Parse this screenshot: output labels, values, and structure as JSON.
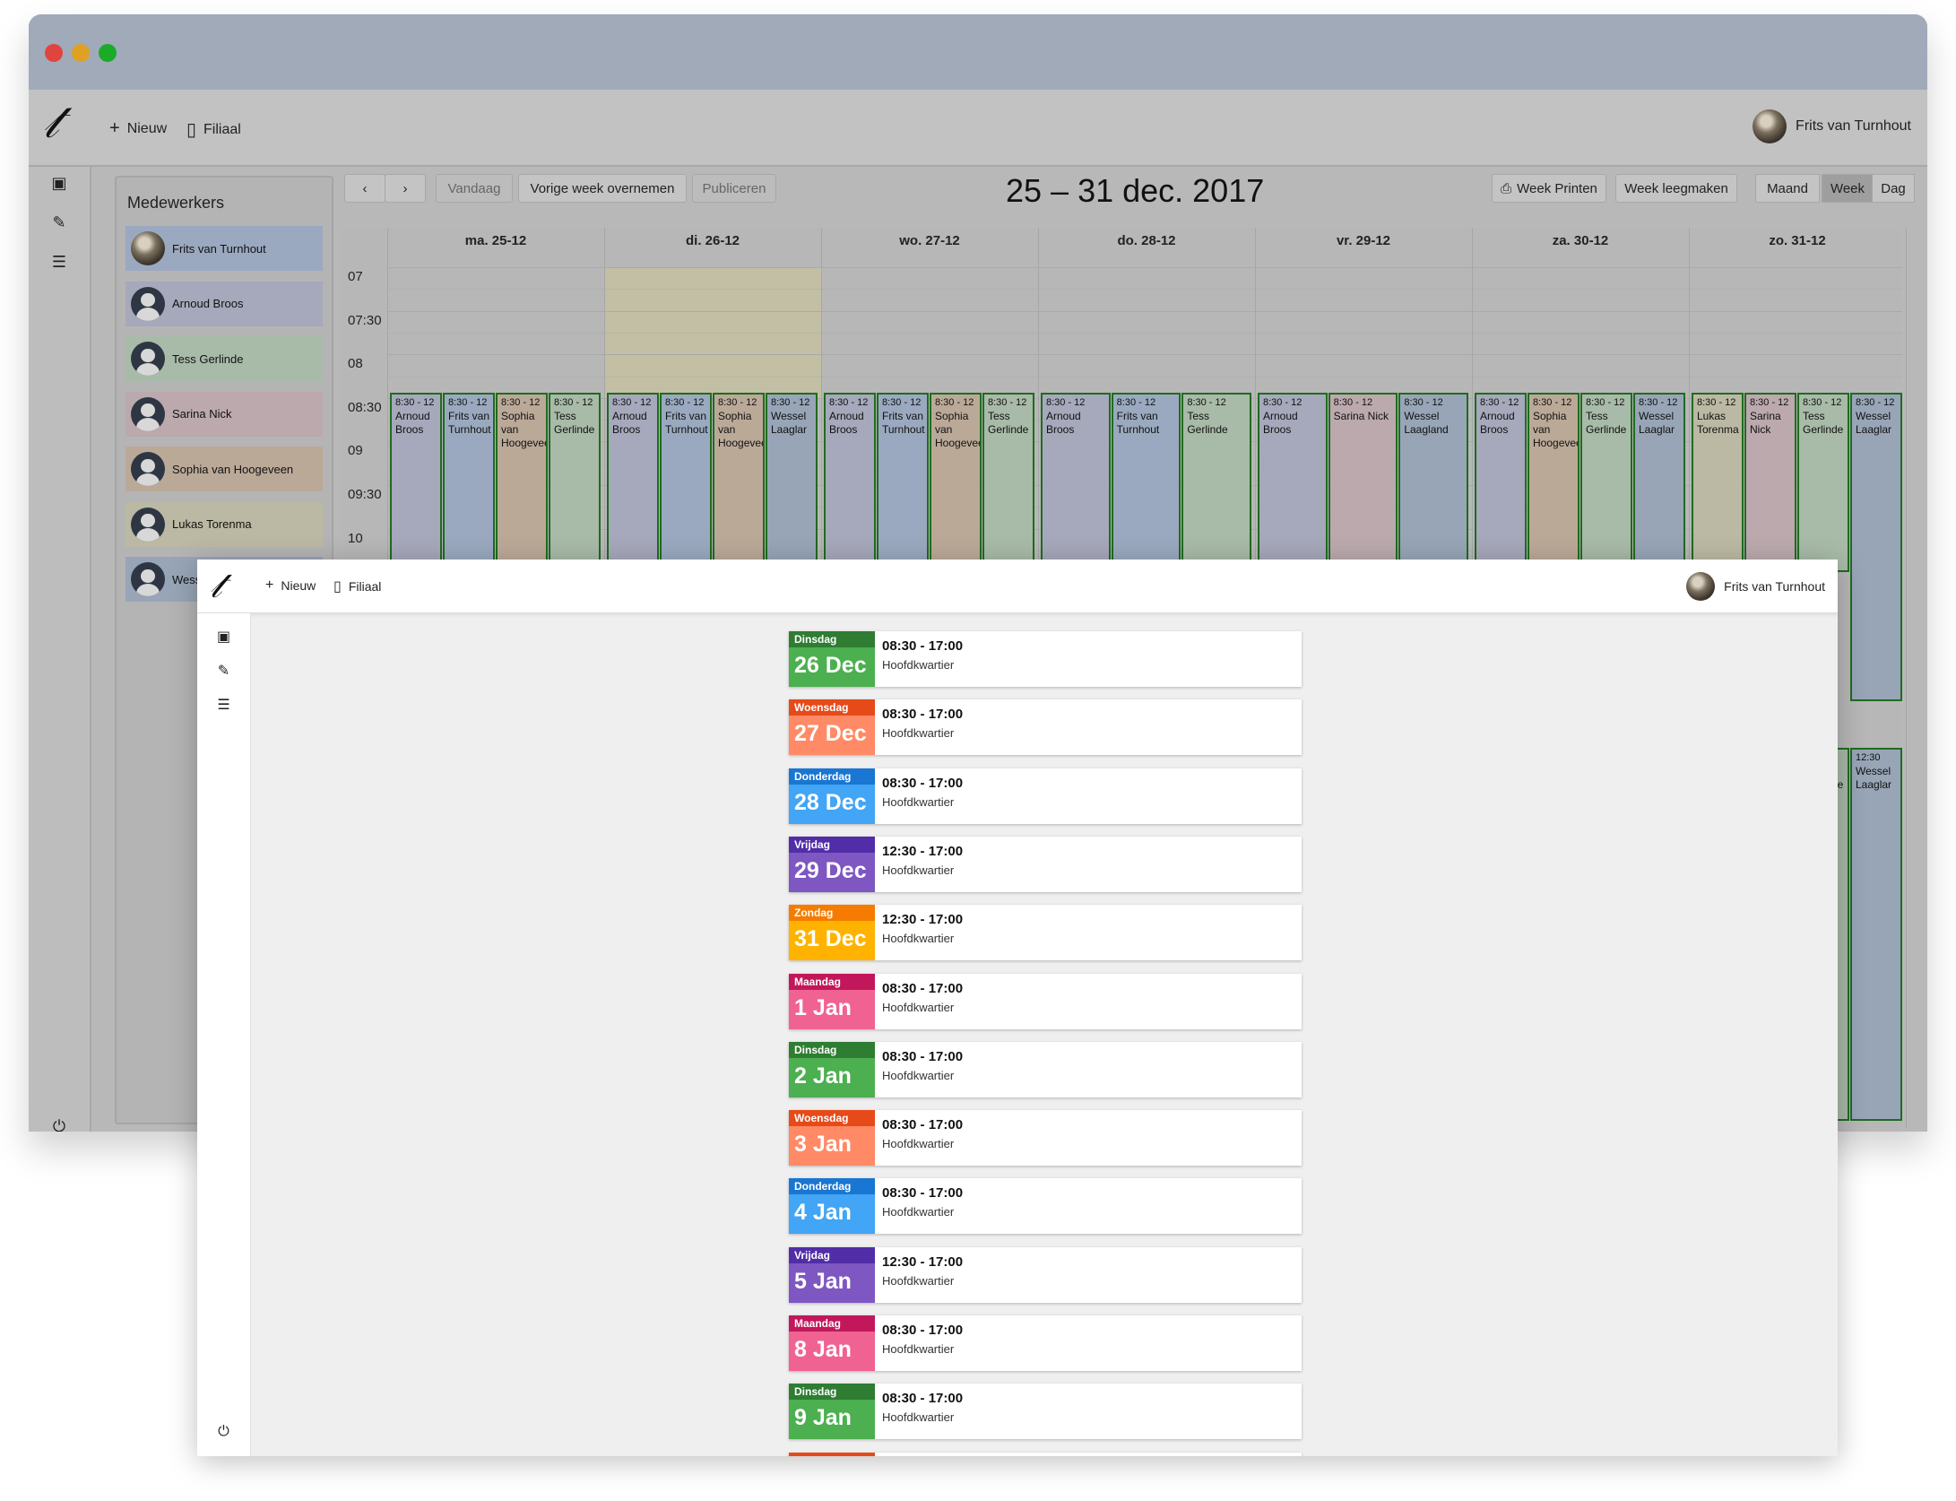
{
  "back": {
    "toolbar": {
      "new": "Nieuw",
      "branch": "Filiaal",
      "user": "Frits van Turnhout"
    },
    "employees_title": "Medewerkers",
    "employees": [
      {
        "name": "Frits van Turnhout",
        "color": "#9aa9bf",
        "photo": true
      },
      {
        "name": "Arnoud Broos",
        "color": "#a6a8bb",
        "photo": false
      },
      {
        "name": "Tess Gerlinde",
        "color": "#a8baa8",
        "photo": false
      },
      {
        "name": "Sarina Nick",
        "color": "#bba9ad",
        "photo": false
      },
      {
        "name": "Sophia van Hoogeveen",
        "color": "#bba998",
        "photo": false
      },
      {
        "name": "Lukas Torenma",
        "color": "#bbb9a3",
        "photo": false
      },
      {
        "name": "Wess",
        "color": "#97a5b7",
        "photo": false
      }
    ],
    "nav": {
      "prev": "‹",
      "next": "›",
      "today": "Vandaag",
      "copy_prev": "Vorige week overnemen",
      "publish": "Publiceren"
    },
    "week_title": "25 – 31 dec. 2017",
    "actions": {
      "print": "Week Printen",
      "clear": "Week leegmaken"
    },
    "views": [
      "Maand",
      "Week",
      "Dag"
    ],
    "active_view": "Week",
    "days": [
      "ma. 25-12",
      "di. 26-12",
      "wo. 27-12",
      "do. 28-12",
      "vr. 29-12",
      "za. 30-12",
      "zo. 31-12"
    ],
    "hours": [
      "07",
      "07:30",
      "08",
      "08:30",
      "09",
      "09:30",
      "10"
    ],
    "shift_time": "8:30 - 12",
    "shift_time_late": "12:30",
    "shifts": [
      [
        "Arnoud Broos",
        "Frits van Turnhout",
        "Sophia van Hoogeveen",
        "Tess Gerlinde"
      ],
      [
        "Arnoud Broos",
        "Frits van Turnhout",
        "Sophia van Hoogeveen",
        "Wessel Laaglar"
      ],
      [
        "Arnoud Broos",
        "Frits van Turnhout",
        "Sophia van Hoogeveen",
        "Tess Gerlinde"
      ],
      [
        "Arnoud Broos",
        "Frits van Turnhout",
        "Tess Gerlinde"
      ],
      [
        "Arnoud Broos",
        "Sarina Nick",
        "Wessel Laagland"
      ],
      [
        "Arnoud Broos",
        "Sophia van Hoogeveen",
        "Tess Gerlinde",
        "Wessel Laaglar"
      ],
      [
        "Lukas Torenma",
        "Sarina Nick",
        "Tess Gerlinde",
        "Wessel Laaglar"
      ]
    ],
    "late_shifts": [
      {
        "name": "Tess Gerlinde"
      },
      {
        "name": "Wessel Laaglar"
      }
    ]
  },
  "front": {
    "toolbar": {
      "new": "Nieuw",
      "branch": "Filiaal",
      "user": "Frits van Turnhout"
    },
    "schedule": [
      {
        "weekday": "Dinsdag",
        "date": "26 Dec",
        "time": "08:30 - 17:00",
        "location": "Hoofdkwartier",
        "head": "#2e7d32",
        "body": "#4caf50"
      },
      {
        "weekday": "Woensdag",
        "date": "27 Dec",
        "time": "08:30 - 17:00",
        "location": "Hoofdkwartier",
        "head": "#e64a19",
        "body": "#ff8a65"
      },
      {
        "weekday": "Donderdag",
        "date": "28 Dec",
        "time": "08:30 - 17:00",
        "location": "Hoofdkwartier",
        "head": "#1976d2",
        "body": "#42a5f5"
      },
      {
        "weekday": "Vrijdag",
        "date": "29 Dec",
        "time": "12:30 - 17:00",
        "location": "Hoofdkwartier",
        "head": "#512da8",
        "body": "#7e57c2"
      },
      {
        "weekday": "Zondag",
        "date": "31 Dec",
        "time": "12:30 - 17:00",
        "location": "Hoofdkwartier",
        "head": "#f57c00",
        "body": "#ffb300"
      },
      {
        "weekday": "Maandag",
        "date": "1 Jan",
        "time": "08:30 - 17:00",
        "location": "Hoofdkwartier",
        "head": "#c2185b",
        "body": "#f06292"
      },
      {
        "weekday": "Dinsdag",
        "date": "2 Jan",
        "time": "08:30 - 17:00",
        "location": "Hoofdkwartier",
        "head": "#2e7d32",
        "body": "#4caf50"
      },
      {
        "weekday": "Woensdag",
        "date": "3 Jan",
        "time": "08:30 - 17:00",
        "location": "Hoofdkwartier",
        "head": "#e64a19",
        "body": "#ff8a65"
      },
      {
        "weekday": "Donderdag",
        "date": "4 Jan",
        "time": "08:30 - 17:00",
        "location": "Hoofdkwartier",
        "head": "#1976d2",
        "body": "#42a5f5"
      },
      {
        "weekday": "Vrijdag",
        "date": "5 Jan",
        "time": "12:30 - 17:00",
        "location": "Hoofdkwartier",
        "head": "#512da8",
        "body": "#7e57c2"
      },
      {
        "weekday": "Maandag",
        "date": "8 Jan",
        "time": "08:30 - 17:00",
        "location": "Hoofdkwartier",
        "head": "#c2185b",
        "body": "#f06292"
      },
      {
        "weekday": "Dinsdag",
        "date": "9 Jan",
        "time": "08:30 - 17:00",
        "location": "Hoofdkwartier",
        "head": "#2e7d32",
        "body": "#4caf50"
      }
    ]
  },
  "icons": {
    "logo": "𝓉",
    "plus": "+",
    "building": "▯",
    "calendar": "▣",
    "pencil": "✎",
    "list": "☰",
    "power": "⏻",
    "printer": "⎙"
  },
  "colors": {
    "titlebar": "#a1aab9",
    "close": "#e0443e",
    "minimize": "#dea123",
    "zoom": "#1aab29",
    "shift_border": "#1f6b1f"
  }
}
